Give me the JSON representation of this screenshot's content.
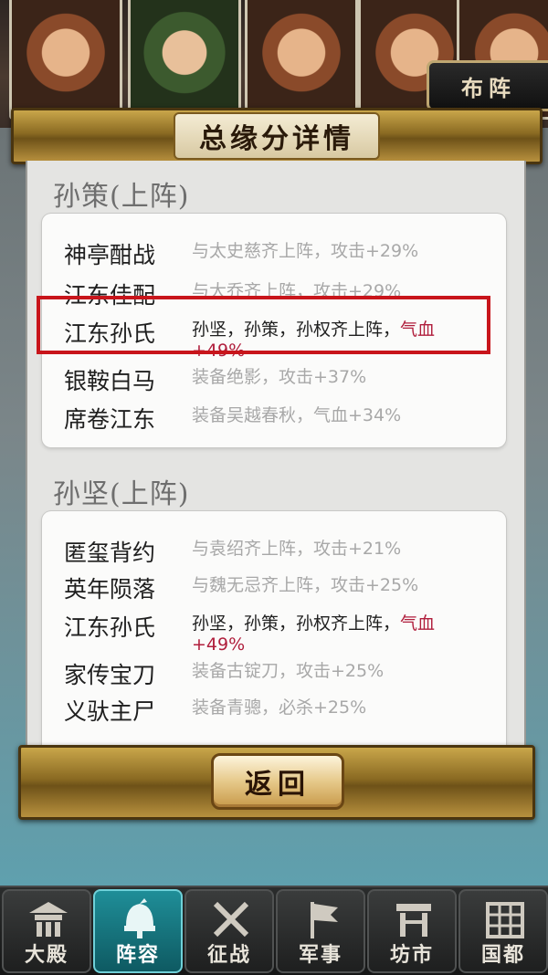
{
  "top_tab": {
    "label": "布阵"
  },
  "dialog": {
    "title": "总缘分详情",
    "sections": [
      {
        "title": "孙策(上阵)",
        "rows": [
          {
            "name": "神亭酣战",
            "desc": "与太史慈齐上阵，攻击+29%",
            "bonus": "",
            "active": false
          },
          {
            "name": "江东佳配",
            "desc": "与大乔齐上阵，攻击+29%",
            "bonus": "",
            "active": false
          },
          {
            "name": "江东孙氏",
            "desc": "孙坚，孙策，孙权齐上阵，",
            "bonus": "气血+49%",
            "active": true
          },
          {
            "name": "银鞍白马",
            "desc": "装备绝影，攻击+37%",
            "bonus": "",
            "active": false
          },
          {
            "name": "席卷江东",
            "desc": "装备吴越春秋，气血+34%",
            "bonus": "",
            "active": false
          }
        ]
      },
      {
        "title": "孙坚(上阵)",
        "rows": [
          {
            "name": "匿玺背约",
            "desc": "与袁绍齐上阵，攻击+21%",
            "bonus": "",
            "active": false
          },
          {
            "name": "英年陨落",
            "desc": "与魏无忌齐上阵，攻击+25%",
            "bonus": "",
            "active": false
          },
          {
            "name": "江东孙氏",
            "desc": "孙坚，孙策，孙权齐上阵，",
            "bonus": "气血+49%",
            "active": true
          },
          {
            "name": "家传宝刀",
            "desc": "装备古锭刀，攻击+25%",
            "bonus": "",
            "active": false
          },
          {
            "name": "义驮主尸",
            "desc": "装备青骢，必杀+25%",
            "bonus": "",
            "active": false
          }
        ]
      }
    ],
    "back_label": "返回"
  },
  "nav": {
    "items": [
      {
        "label": "大殿",
        "icon": "palace-icon",
        "active": false
      },
      {
        "label": "阵容",
        "icon": "helmet-icon",
        "active": true
      },
      {
        "label": "征战",
        "icon": "crossed-swords-icon",
        "active": false
      },
      {
        "label": "军事",
        "icon": "flag-icon",
        "active": false
      },
      {
        "label": "坊市",
        "icon": "market-stall-icon",
        "active": false
      },
      {
        "label": "国都",
        "icon": "city-wall-icon",
        "active": false
      }
    ]
  },
  "colors": {
    "bonus": "#b01e3c",
    "highlight": "#c8151b",
    "nav_active": "#1f8e98"
  }
}
